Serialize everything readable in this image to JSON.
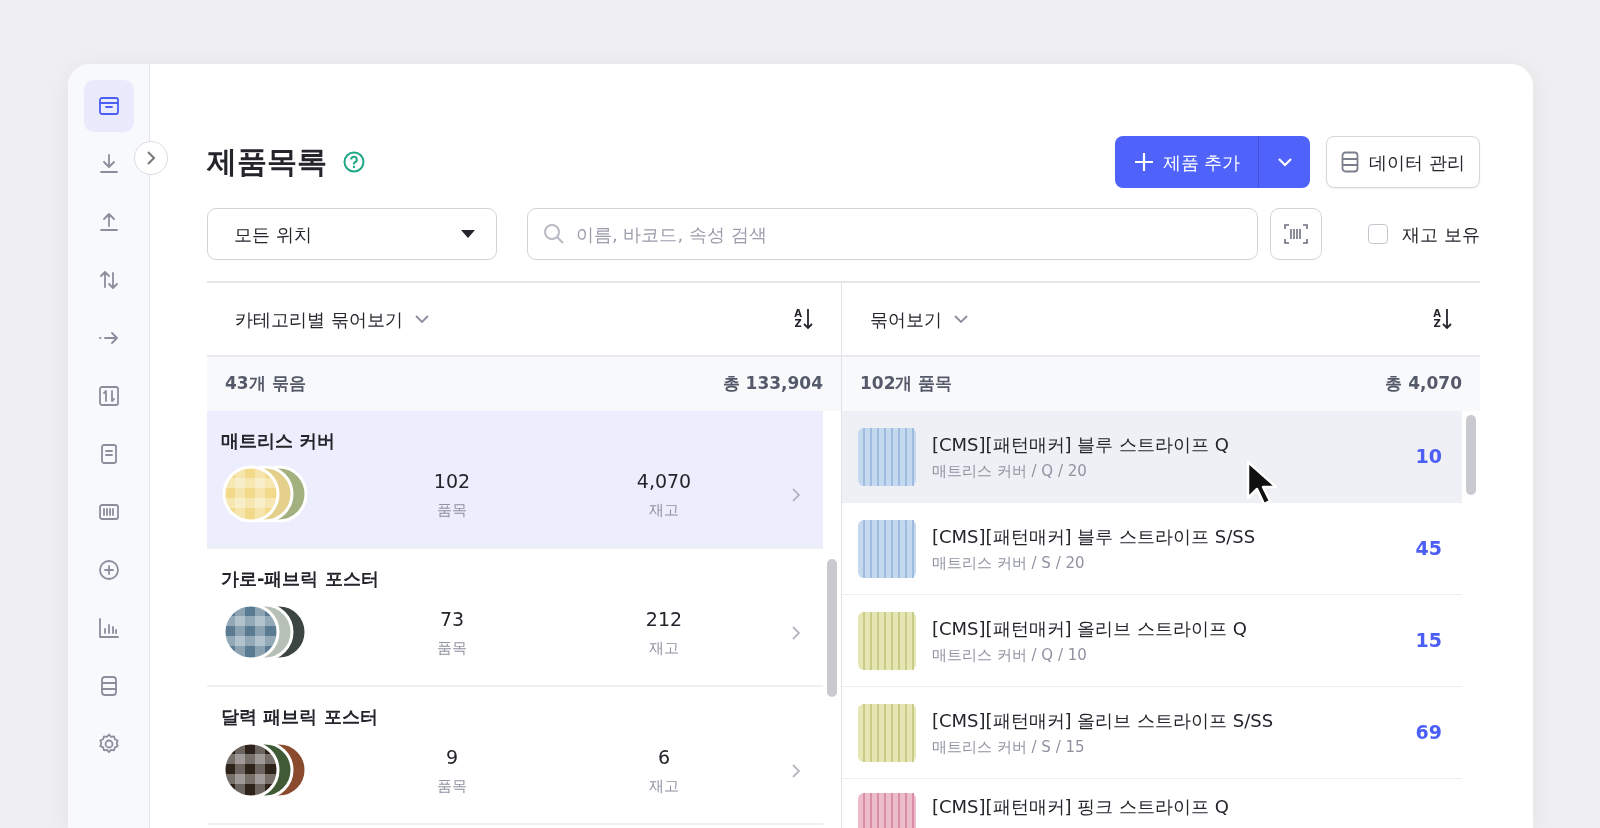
{
  "sidebar": {
    "items": [
      {
        "selected": true
      },
      {
        "selected": false
      },
      {
        "selected": false
      },
      {
        "selected": false
      },
      {
        "selected": false
      },
      {
        "selected": false
      },
      {
        "selected": false
      },
      {
        "selected": false
      },
      {
        "selected": false
      },
      {
        "selected": false
      },
      {
        "selected": false
      },
      {
        "selected": false
      }
    ]
  },
  "page": {
    "title": "제품목록"
  },
  "actions": {
    "add": "제품 추가",
    "data": "데이터 관리"
  },
  "filters": {
    "location": "모든 위치",
    "search": {
      "placeholder": "이름, 바코드, 속성 검색"
    },
    "in_stock": {
      "label": "재고 보유",
      "checked": false
    }
  },
  "groups_panel": {
    "group_by": "카테고리별 묶어보기",
    "sort": [
      "A",
      "Z"
    ],
    "count": "43개 묶음",
    "total": "총 133,904",
    "items": [
      {
        "name": "매트리스 커버",
        "items_count": "102",
        "items_label": "품목",
        "stock": "4,070",
        "stock_label": "재고",
        "selected": true
      },
      {
        "name": "가로-패브릭 포스터",
        "items_count": "73",
        "items_label": "품목",
        "stock": "212",
        "stock_label": "재고",
        "selected": false
      },
      {
        "name": "달력 패브릭 포스터",
        "items_count": "9",
        "items_label": "품목",
        "stock": "6",
        "stock_label": "재고",
        "selected": false
      }
    ]
  },
  "products_panel": {
    "group_by": "묶어보기",
    "sort": [
      "A",
      "Z"
    ],
    "count": "102개 품목",
    "total": "총 4,070",
    "items": [
      {
        "title": "[CMS][패턴매커] 블루 스트라이프 Q",
        "sub": "매트리스 커버 / Q / 20",
        "quantity": "10",
        "hovered": true
      },
      {
        "title": "[CMS][패턴매커] 블루 스트라이프 S/SS",
        "sub": "매트리스 커버 / S / 20",
        "quantity": "45",
        "hovered": false
      },
      {
        "title": "[CMS][패턴매커] 올리브 스트라이프 Q",
        "sub": "매트리스 커버 / Q / 10",
        "quantity": "15",
        "hovered": false
      },
      {
        "title": "[CMS][패턴매커] 올리브 스트라이프 S/SS",
        "sub": "매트리스 커버 / S / 15",
        "quantity": "69",
        "hovered": false
      },
      {
        "title": "[CMS][패턴매커] 핑크 스트라이프 Q",
        "hovered": false
      }
    ]
  }
}
